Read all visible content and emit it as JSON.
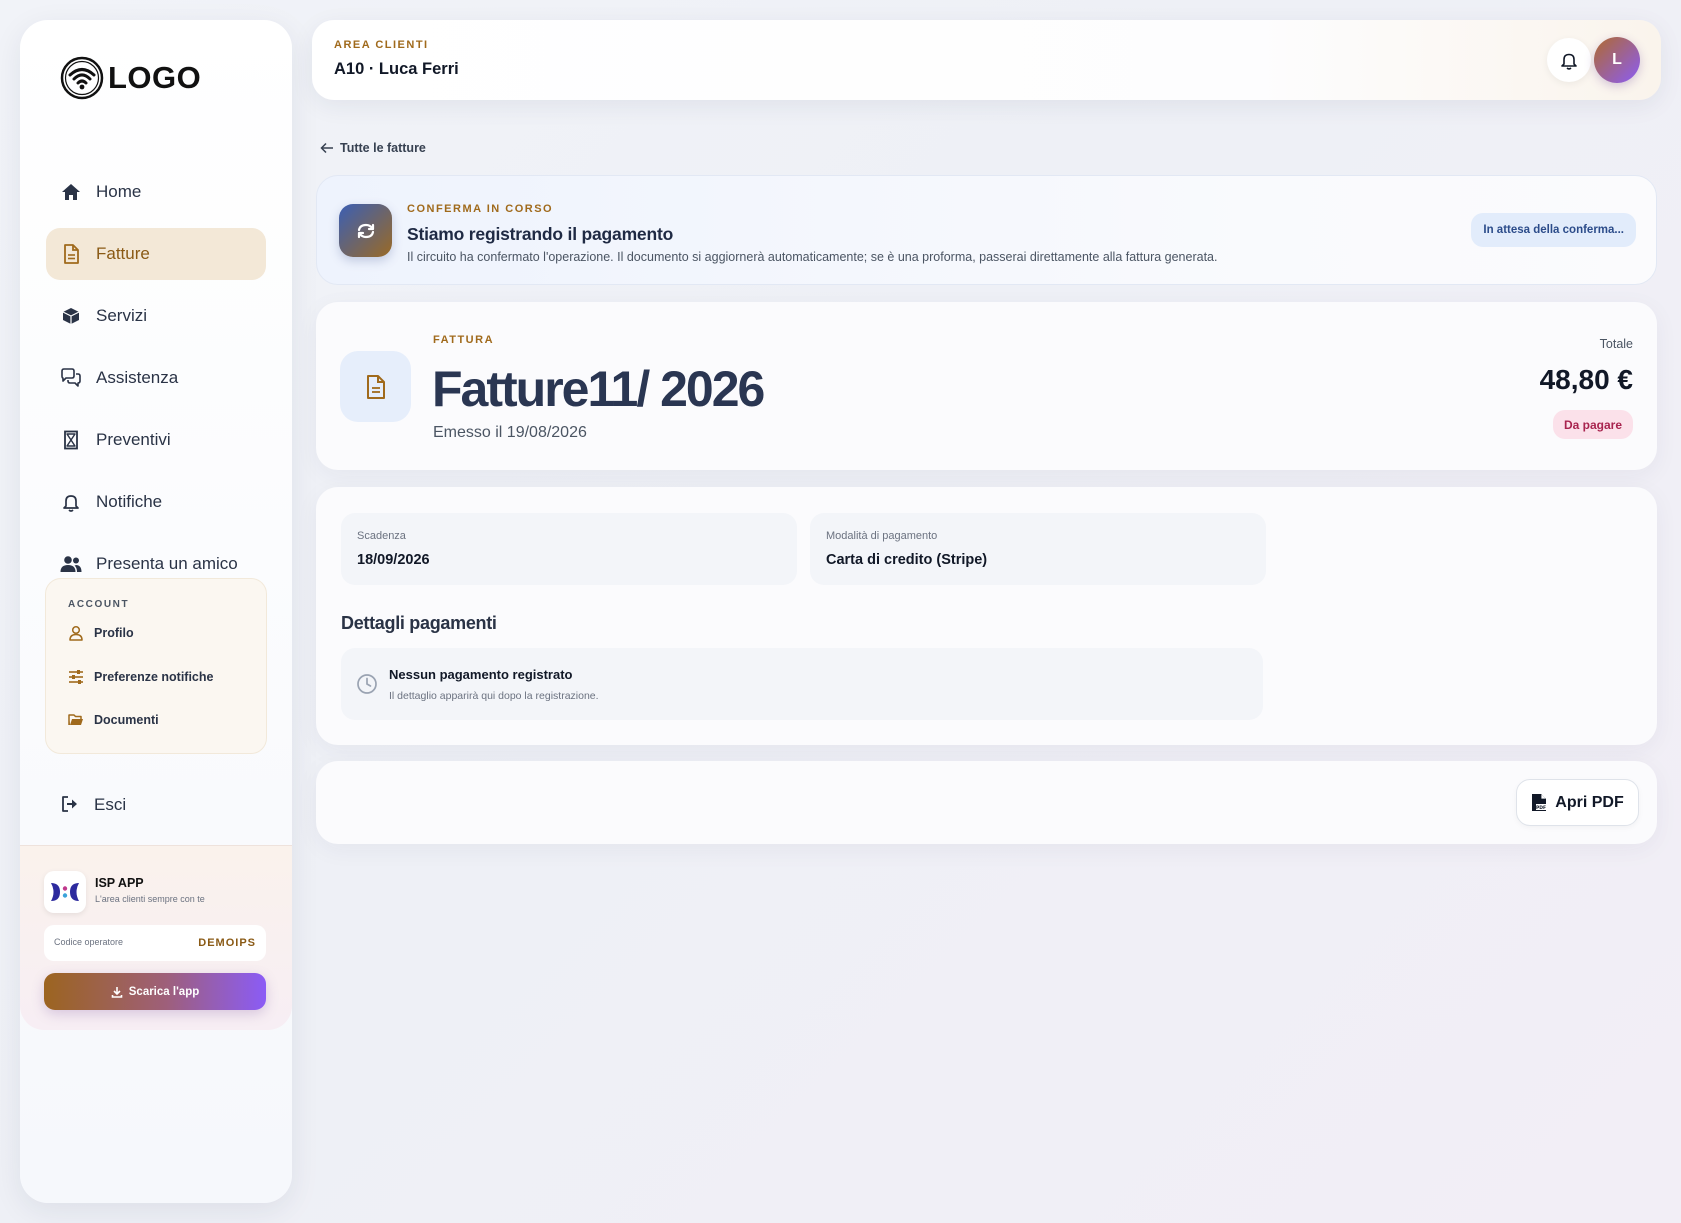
{
  "sidebar": {
    "logo_text": "LOGO",
    "nav": [
      {
        "label": "Home",
        "icon": "home-icon"
      },
      {
        "label": "Fatture",
        "icon": "document-icon",
        "active": true
      },
      {
        "label": "Servizi",
        "icon": "box-icon"
      },
      {
        "label": "Assistenza",
        "icon": "chat-icon"
      },
      {
        "label": "Preventivi",
        "icon": "hourglass-icon"
      },
      {
        "label": "Notifiche",
        "icon": "bell-icon"
      },
      {
        "label": "Presenta un amico",
        "icon": "users-icon"
      }
    ],
    "account": {
      "title": "ACCOUNT",
      "items": [
        {
          "label": "Profilo",
          "icon": "user-icon"
        },
        {
          "label": "Preferenze notifiche",
          "icon": "sliders-icon"
        },
        {
          "label": "Documenti",
          "icon": "folder-icon"
        }
      ]
    },
    "logout_label": "Esci",
    "app": {
      "name": "ISP APP",
      "subtitle": "L'area clienti sempre con te",
      "operator_label": "Codice operatore",
      "operator_code": "DEMOIPS",
      "download_label": "Scarica l'app"
    }
  },
  "header": {
    "kicker": "AREA CLIENTI",
    "title": "A10 · Luca Ferri",
    "avatar_initial": "L"
  },
  "back_label": "Tutte le fatture",
  "confirm": {
    "kicker": "CONFERMA IN CORSO",
    "title": "Stiamo registrando il pagamento",
    "description": "Il circuito ha confermato l'operazione. Il documento si aggiornerà automaticamente; se è una proforma, passerai direttamente alla fattura generata.",
    "badge": "In attesa della conferma..."
  },
  "invoice": {
    "kicker": "FATTURA",
    "number": "Fatture11/ 2026",
    "issued": "Emesso il 19/08/2026",
    "total_label": "Totale",
    "total": "48,80 €",
    "status": "Da pagare"
  },
  "details": {
    "due_label": "Scadenza",
    "due_value": "18/09/2026",
    "method_label": "Modalità di pagamento",
    "method_value": "Carta di credito (Stripe)",
    "payments_title": "Dettagli pagamenti",
    "empty_title": "Nessun pagamento registrato",
    "empty_sub": "Il dettaglio apparirà qui dopo la registrazione."
  },
  "actions": {
    "pdf_label": "Apri PDF"
  },
  "colors": {
    "accent_gold": "#a06a1c",
    "active_bg": "#f3e8d7",
    "status_pink": "#fbe1ea",
    "badge_blue": "#e2ecfb"
  }
}
